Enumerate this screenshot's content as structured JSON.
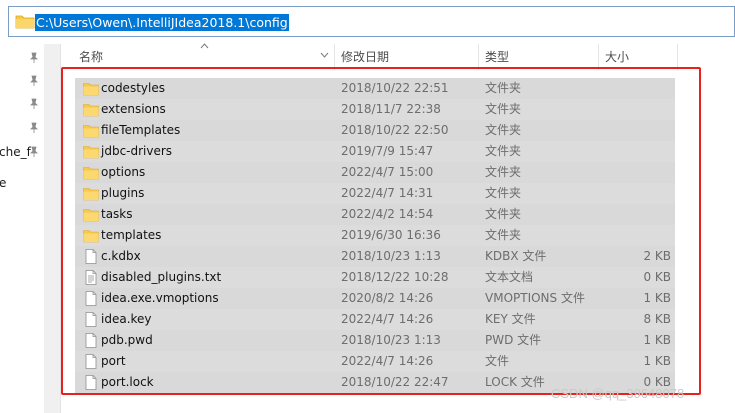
{
  "address": {
    "path": "C:\\Users\\Owen\\.IntelliJIdea2018.1\\config"
  },
  "left_pane": {
    "truncated_items": [
      "che_f",
      "e"
    ]
  },
  "columns": {
    "name": "名称",
    "date": "修改日期",
    "type": "类型",
    "size": "大小"
  },
  "files": [
    {
      "icon": "folder-icon",
      "name": "codestyles",
      "date": "2018/10/22 22:51",
      "type": "文件夹",
      "size": ""
    },
    {
      "icon": "folder-icon",
      "name": "extensions",
      "date": "2018/11/7 22:38",
      "type": "文件夹",
      "size": ""
    },
    {
      "icon": "folder-icon",
      "name": "fileTemplates",
      "date": "2018/10/22 22:50",
      "type": "文件夹",
      "size": ""
    },
    {
      "icon": "folder-icon",
      "name": "jdbc-drivers",
      "date": "2019/7/9 15:47",
      "type": "文件夹",
      "size": ""
    },
    {
      "icon": "folder-icon",
      "name": "options",
      "date": "2022/4/7 15:00",
      "type": "文件夹",
      "size": ""
    },
    {
      "icon": "folder-icon",
      "name": "plugins",
      "date": "2022/4/7 14:31",
      "type": "文件夹",
      "size": ""
    },
    {
      "icon": "folder-icon",
      "name": "tasks",
      "date": "2022/4/2 14:54",
      "type": "文件夹",
      "size": ""
    },
    {
      "icon": "folder-icon",
      "name": "templates",
      "date": "2019/6/30 16:36",
      "type": "文件夹",
      "size": ""
    },
    {
      "icon": "file-icon",
      "name": "c.kdbx",
      "date": "2018/10/23 1:13",
      "type": "KDBX 文件",
      "size": "2 KB"
    },
    {
      "icon": "text-file-icon",
      "name": "disabled_plugins.txt",
      "date": "2018/12/22 10:28",
      "type": "文本文档",
      "size": "0 KB"
    },
    {
      "icon": "file-icon",
      "name": "idea.exe.vmoptions",
      "date": "2020/8/2 14:26",
      "type": "VMOPTIONS 文件",
      "size": "1 KB"
    },
    {
      "icon": "file-icon",
      "name": "idea.key",
      "date": "2022/4/7 14:26",
      "type": "KEY 文件",
      "size": "8 KB"
    },
    {
      "icon": "file-icon",
      "name": "pdb.pwd",
      "date": "2018/10/23 1:13",
      "type": "PWD 文件",
      "size": "1 KB"
    },
    {
      "icon": "file-icon",
      "name": "port",
      "date": "2022/4/7 14:26",
      "type": "文件",
      "size": "1 KB"
    },
    {
      "icon": "file-icon",
      "name": "port.lock",
      "date": "2018/10/22 22:47",
      "type": "LOCK 文件",
      "size": "0 KB"
    }
  ],
  "watermark": "CSDN @qq_39648078",
  "colors": {
    "selection": "#0078d7",
    "row_highlight": "#d9d9d9",
    "annotation": "#e8211c",
    "folder": "#f8c84a"
  }
}
